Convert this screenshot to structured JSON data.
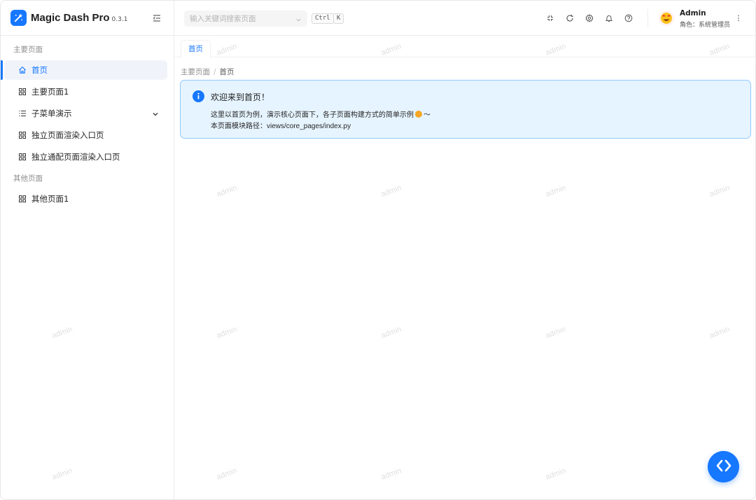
{
  "brand": {
    "name": "Magic Dash Pro",
    "version": "0.3.1"
  },
  "sidebar": {
    "groups": [
      {
        "title": "主要页面"
      },
      {
        "title": "其他页面"
      }
    ],
    "items": [
      {
        "label": "首页",
        "icon": "home-icon",
        "active": true
      },
      {
        "label": "主要页面1",
        "icon": "grid-icon"
      },
      {
        "label": "子菜单演示",
        "icon": "list-icon",
        "expandable": true
      },
      {
        "label": "独立页面渲染入口页",
        "icon": "grid-icon"
      },
      {
        "label": "独立通配页面渲染入口页",
        "icon": "grid-icon"
      },
      {
        "label": "其他页面1",
        "icon": "grid-icon"
      }
    ]
  },
  "header": {
    "search_placeholder": "输入关键词搜索页面",
    "shortcut": [
      "Ctrl",
      "K"
    ],
    "tools": [
      "fullscreen-icon",
      "refresh-icon",
      "settings-icon",
      "bell-icon",
      "help-icon"
    ],
    "user": {
      "name": "Admin",
      "role": "角色：系统管理员"
    }
  },
  "tabs": [
    {
      "label": "首页"
    }
  ],
  "breadcrumb": [
    "主要页面",
    "首页"
  ],
  "alert": {
    "title": "欢迎来到首页！",
    "line1": "这里以首页为例，演示核心页面下，各子页面构建方式的简单示例",
    "line1_suffix": "～",
    "line2_prefix": "本页面模块路径：",
    "line2_path": "views/core_pages/index.py"
  },
  "watermark": "admin",
  "colors": {
    "primary": "#1677ff",
    "alert_bg": "#e6f4ff",
    "alert_border": "#91caff"
  }
}
